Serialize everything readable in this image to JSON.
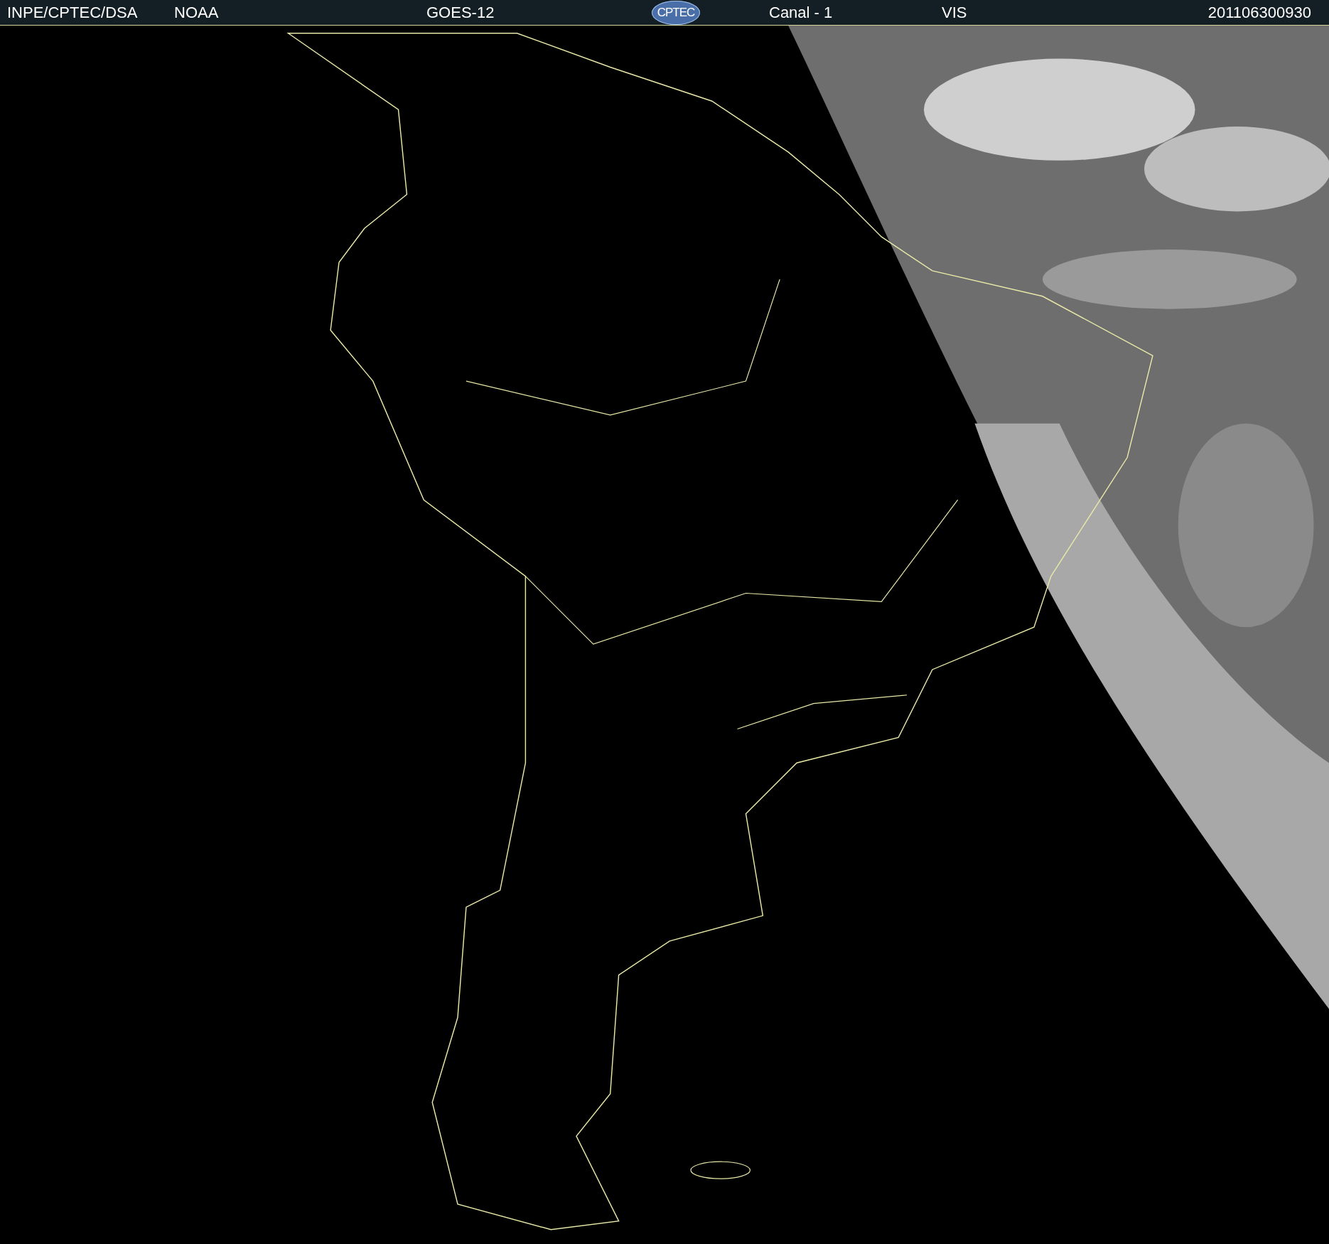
{
  "header": {
    "source": "INPE/CPTEC/DSA",
    "agency": "NOAA",
    "satellite": "GOES-12",
    "logo_text": "CPTEC",
    "channel": "Canal - 1",
    "band": "VIS",
    "timestamp": "201106300930"
  }
}
